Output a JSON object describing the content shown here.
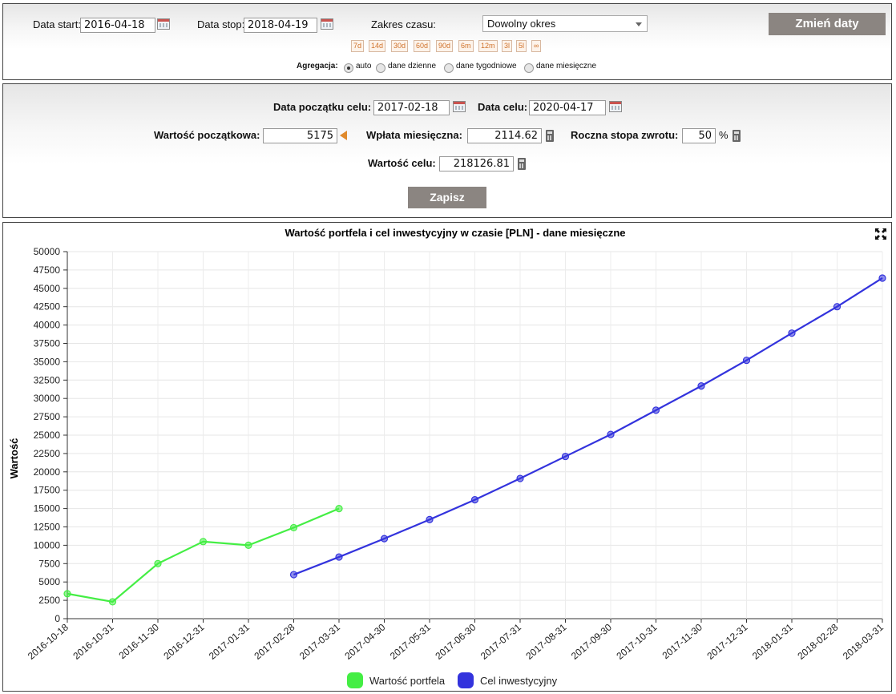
{
  "filters": {
    "start_label": "Data start:",
    "start_value": "2016-04-18",
    "stop_label": "Data stop:",
    "stop_value": "2018-04-19",
    "range_label": "Zakres czasu:",
    "range_value": "Dowolny okres",
    "apply_button": "Zmień daty",
    "quick_ranges": [
      "7d",
      "14d",
      "30d",
      "60d",
      "90d",
      "6m",
      "12m",
      "3l",
      "5l",
      "∞"
    ],
    "aggregation_label": "Agregacja:",
    "aggregation_options": [
      "auto",
      "dane dzienne",
      "dane tygodniowe",
      "dane miesięczne"
    ],
    "aggregation_selected": "auto"
  },
  "goal": {
    "start_label": "Data początku celu:",
    "start_value": "2017-02-18",
    "target_date_label": "Data celu:",
    "target_date_value": "2020-04-17",
    "initial_label": "Wartość początkowa:",
    "initial_value": "5175",
    "monthly_label": "Wpłata miesięczna:",
    "monthly_value": "2114.62",
    "rate_label": "Roczna stopa zwrotu:",
    "rate_value": "50",
    "rate_unit": "%",
    "target_value_label": "Wartość celu:",
    "target_value": "218126.81",
    "save_button": "Zapisz"
  },
  "chart_data": {
    "type": "line",
    "title": "Wartość portfela i cel inwestycyjny w czasie [PLN] - dane miesięczne",
    "xlabel": "",
    "ylabel": "Wartość",
    "ylim": [
      0,
      50000
    ],
    "yticks": [
      0,
      2500,
      5000,
      7500,
      10000,
      12500,
      15000,
      17500,
      20000,
      22500,
      25000,
      27500,
      30000,
      32500,
      35000,
      37500,
      40000,
      42500,
      45000,
      47500,
      50000
    ],
    "categories": [
      "2016-10-18",
      "2016-10-31",
      "2016-11-30",
      "2016-12-31",
      "2017-01-31",
      "2017-02-28",
      "2017-03-31",
      "2017-04-30",
      "2017-05-31",
      "2017-06-30",
      "2017-07-31",
      "2017-08-31",
      "2017-09-30",
      "2017-10-31",
      "2017-11-30",
      "2017-12-31",
      "2018-01-31",
      "2018-02-28",
      "2018-03-31"
    ],
    "grid": true,
    "legend_position": "bottom",
    "series": [
      {
        "name": "Wartość portfela",
        "color": "#44ee44",
        "values": [
          3400,
          2300,
          7500,
          10500,
          10000,
          12400,
          15000,
          null,
          null,
          null,
          null,
          null,
          null,
          null,
          null,
          null,
          null,
          null,
          null
        ]
      },
      {
        "name": "Cel inwestycyjny",
        "color": "#3333dd",
        "values": [
          null,
          null,
          null,
          null,
          null,
          6000,
          8400,
          10900,
          13500,
          16200,
          19100,
          22100,
          25100,
          28400,
          31700,
          35200,
          38900,
          42500,
          46400
        ]
      }
    ]
  }
}
